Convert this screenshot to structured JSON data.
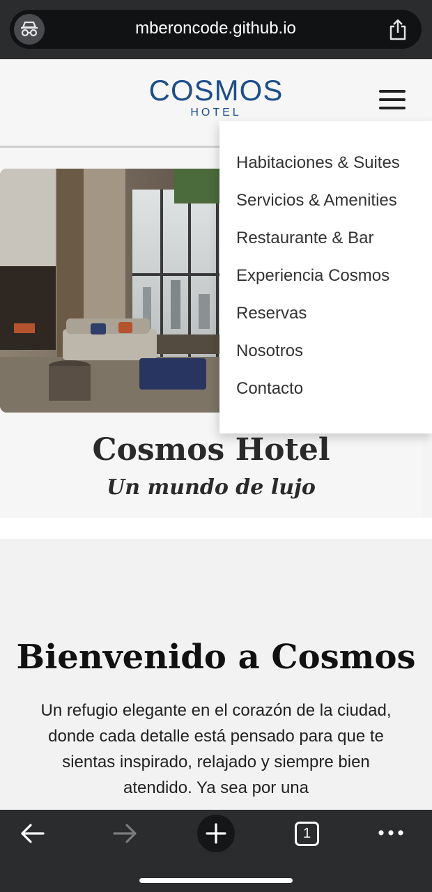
{
  "browser": {
    "url": "mberoncode.github.io",
    "tab_count": "1",
    "icons": [
      "incognito-icon",
      "share-icon",
      "back-arrow-icon",
      "forward-arrow-icon",
      "plus-icon",
      "tabs-icon",
      "more-icon"
    ]
  },
  "header": {
    "logo_main": "COSMOS",
    "logo_sub": "HOTEL",
    "brand_color": "#1d4e8a"
  },
  "menu": {
    "items": [
      "Habitaciones & Suites",
      "Servicios & Amenities",
      "Restaurante & Bar",
      "Experiencia Cosmos",
      "Reservas",
      "Nosotros",
      "Contacto"
    ]
  },
  "hero": {
    "title": "Cosmos Hotel",
    "subtitle": "Un mundo de lujo"
  },
  "welcome": {
    "title": "Bienvenido a Cosmos",
    "text": "Un refugio elegante en el corazón de la ciudad, donde cada detalle está pensado para que te sientas inspirado, relajado y siempre bien atendido. Ya sea por una"
  }
}
